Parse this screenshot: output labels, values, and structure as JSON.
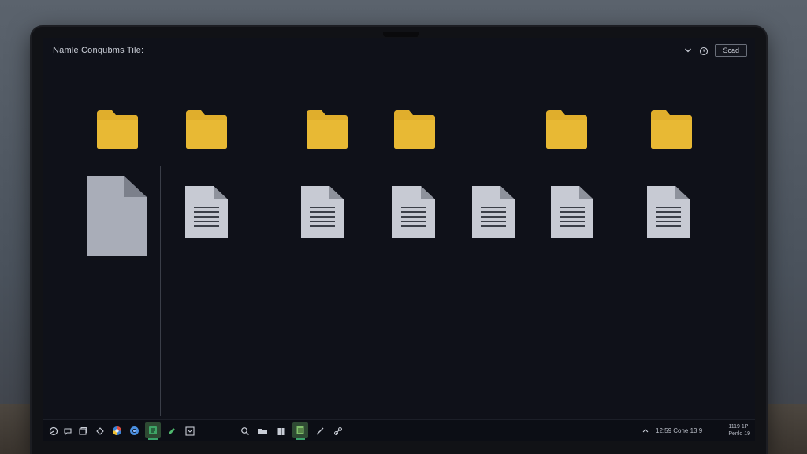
{
  "window": {
    "title": "Namle Conqubms  Tile:",
    "send_label": "Scad"
  },
  "icons": {
    "collapse": "chevron-down-icon",
    "history": "clock-icon"
  },
  "colors": {
    "folder": "#e0ae2c",
    "document": "#c7cad3",
    "screen_bg": "#0f1119"
  },
  "folders": [
    {
      "name": "folder"
    },
    {
      "name": "folder"
    },
    {
      "name": "folder"
    },
    {
      "name": "folder"
    },
    {
      "name": "folder"
    },
    {
      "name": "folder"
    }
  ],
  "documents": [
    {
      "name": "document"
    },
    {
      "name": "document"
    },
    {
      "name": "document"
    },
    {
      "name": "document"
    },
    {
      "name": "document"
    },
    {
      "name": "document"
    }
  ],
  "taskbar": {
    "tray_text": "12:59  Cone 13 9",
    "clock_line1": "1119 1P",
    "clock_line2": "Penlo 19"
  }
}
